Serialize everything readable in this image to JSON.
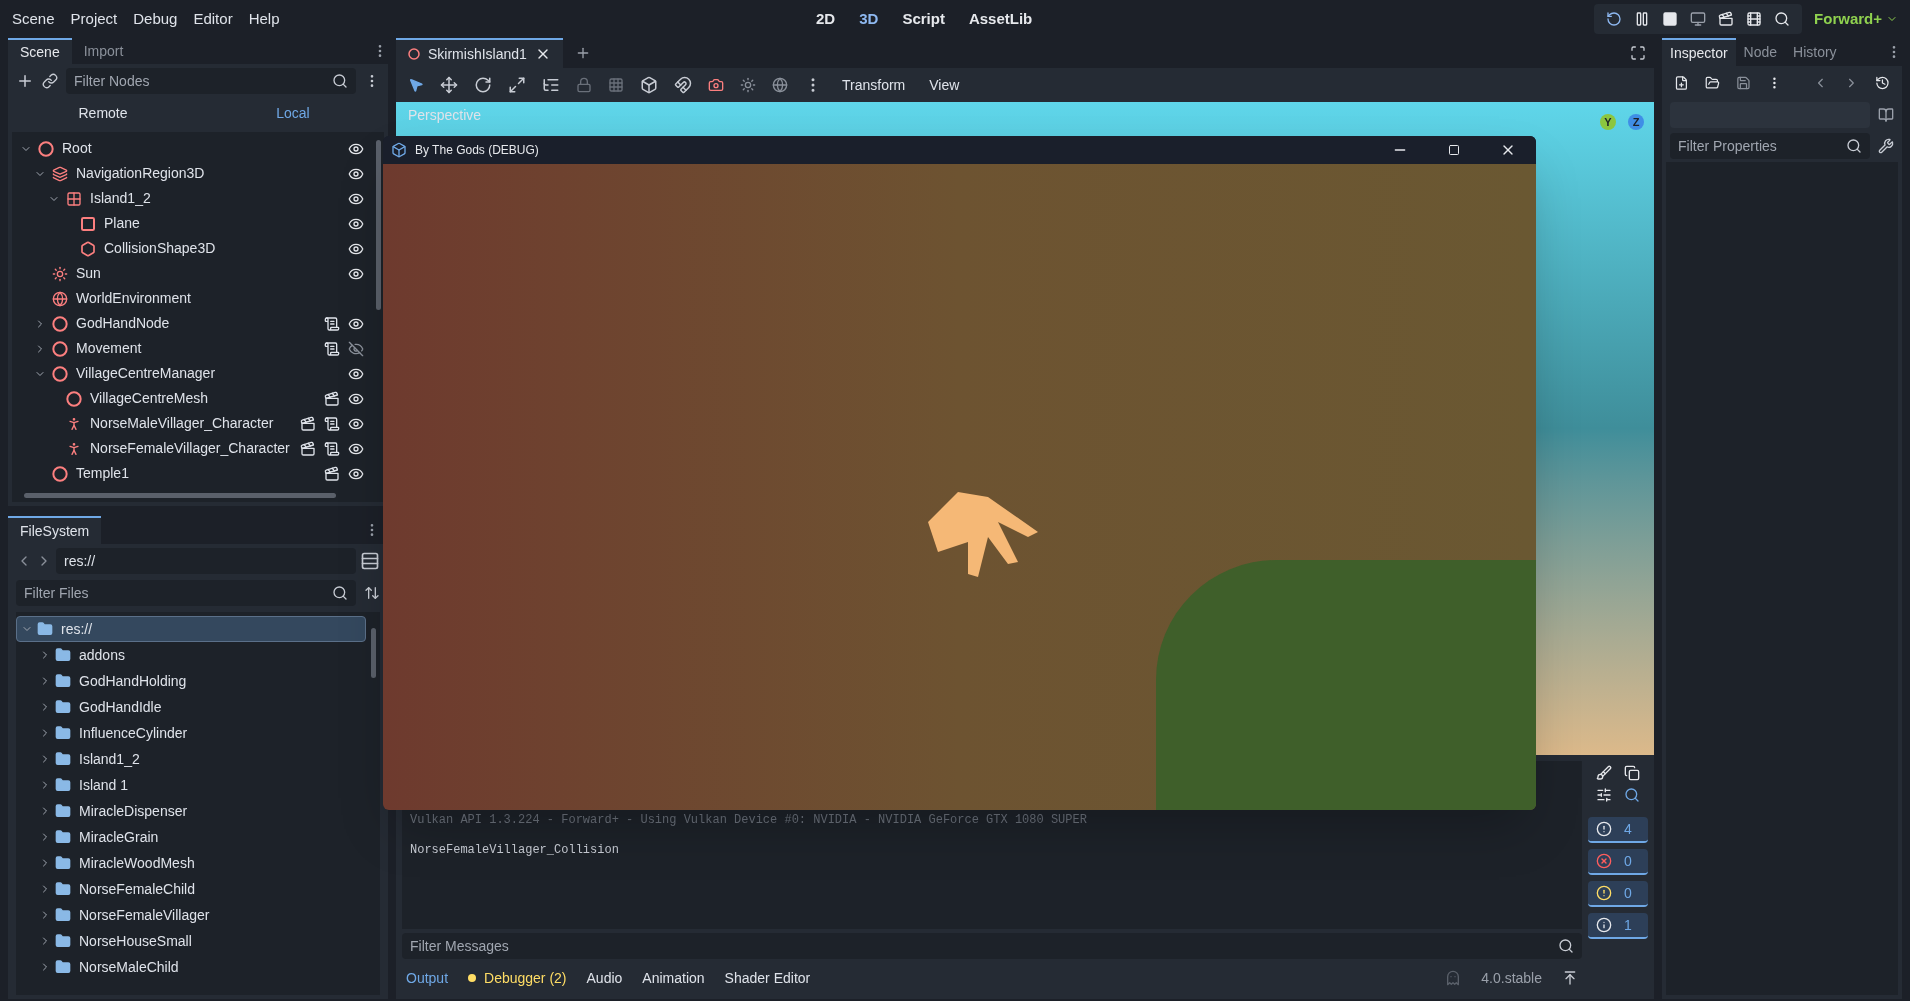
{
  "menu_bar": {
    "menus": [
      "Scene",
      "Project",
      "Debug",
      "Editor",
      "Help"
    ],
    "workspaces": [
      {
        "label": "2D",
        "selected": false
      },
      {
        "label": "3D",
        "selected": true
      },
      {
        "label": "Script",
        "selected": false
      },
      {
        "label": "AssetLib",
        "selected": false
      }
    ],
    "renderer": "Forward+"
  },
  "scene_dock": {
    "tabs": [
      {
        "label": "Scene",
        "selected": true
      },
      {
        "label": "Import",
        "selected": false
      }
    ],
    "filter_placeholder": "Filter Nodes",
    "modes": [
      {
        "label": "Remote",
        "selected": false
      },
      {
        "label": "Local",
        "selected": true
      }
    ],
    "tree": [
      {
        "name": "Root",
        "kind": "node3d",
        "expanded": true,
        "visible": true,
        "children": [
          {
            "name": "NavigationRegion3D",
            "kind": "navregion",
            "expanded": true,
            "visible": true,
            "children": [
              {
                "name": "Island1_2",
                "kind": "mesh",
                "expanded": true,
                "visible": true,
                "children": [
                  {
                    "name": "Plane",
                    "kind": "plane",
                    "visible": true
                  },
                  {
                    "name": "CollisionShape3D",
                    "kind": "collision",
                    "visible": true
                  }
                ]
              }
            ]
          },
          {
            "name": "Sun",
            "kind": "light",
            "visible": true
          },
          {
            "name": "WorldEnvironment",
            "kind": "environment"
          },
          {
            "name": "GodHandNode",
            "kind": "node3d",
            "expanded": false,
            "script": true,
            "visible": true
          },
          {
            "name": "Movement",
            "kind": "node3d",
            "expanded": false,
            "script": true,
            "visible": false
          },
          {
            "name": "VillageCentreManager",
            "kind": "node3d",
            "expanded": true,
            "visible": true,
            "children": [
              {
                "name": "VillageCentreMesh",
                "kind": "node3d",
                "instanced": true,
                "visible": true
              },
              {
                "name": "NorseMaleVillager_Character",
                "kind": "character",
                "instanced": true,
                "script": true,
                "visible": true
              },
              {
                "name": "NorseFemaleVillager_Character",
                "kind": "character",
                "instanced": true,
                "script": true,
                "visible": true
              }
            ]
          },
          {
            "name": "Temple1",
            "kind": "node3d",
            "instanced": true,
            "visible": true
          }
        ]
      }
    ]
  },
  "filesystem_dock": {
    "tab": "FileSystem",
    "path": "res://",
    "filter_placeholder": "Filter Files",
    "tree": [
      {
        "name": "res://",
        "selected": true,
        "expanded": true,
        "children": [
          {
            "name": "addons",
            "selected": false,
            "expanded": false
          },
          {
            "name": "GodHandHolding",
            "selected": false,
            "expanded": false
          },
          {
            "name": "GodHandIdle",
            "selected": false,
            "expanded": false
          },
          {
            "name": "InfluenceCylinder",
            "selected": false,
            "expanded": false
          },
          {
            "name": "Island1_2",
            "selected": false,
            "expanded": false
          },
          {
            "name": "Island 1",
            "selected": false,
            "expanded": false
          },
          {
            "name": "MiracleDispenser",
            "selected": false,
            "expanded": false
          },
          {
            "name": "MiracleGrain",
            "selected": false,
            "expanded": false
          },
          {
            "name": "MiracleWoodMesh",
            "selected": false,
            "expanded": false
          },
          {
            "name": "NorseFemaleChild",
            "selected": false,
            "expanded": false
          },
          {
            "name": "NorseFemaleVillager",
            "selected": false,
            "expanded": false
          },
          {
            "name": "NorseHouseSmall",
            "selected": false,
            "expanded": false
          },
          {
            "name": "NorseMaleChild",
            "selected": false,
            "expanded": false
          }
        ]
      }
    ]
  },
  "editor": {
    "scene_tabs": [
      {
        "label": "SkirmishIsland1",
        "selected": true
      }
    ],
    "toolbar_menus": [
      "Transform",
      "View"
    ],
    "viewport": {
      "label": "Perspective",
      "gizmo_axes": [
        {
          "label": "Y",
          "color": "#8cc63f"
        },
        {
          "label": "Z",
          "color": "#3f8ee6"
        }
      ]
    }
  },
  "game_window": {
    "title": "By The Gods (DEBUG)"
  },
  "bottom_panel": {
    "output_lines": [
      "Vulkan API 1.3.224 - Forward+ - Using Vulkan Device #0: NVIDIA - NVIDIA GeForce GTX 1080 SUPER",
      "NorseFemaleVillager_Collision"
    ],
    "filter_placeholder": "Filter Messages",
    "counters": [
      {
        "kind": "log",
        "count": "4",
        "selected": true
      },
      {
        "kind": "error",
        "count": "0",
        "selected": true
      },
      {
        "kind": "warning",
        "count": "0",
        "selected": true
      },
      {
        "kind": "info",
        "count": "1",
        "selected": true
      }
    ],
    "tabs": [
      {
        "label": "Output",
        "selected": true,
        "alert": false
      },
      {
        "label": "Debugger (2)",
        "selected": false,
        "alert": true
      },
      {
        "label": "Audio",
        "selected": false,
        "alert": false
      },
      {
        "label": "Animation",
        "selected": false,
        "alert": false
      },
      {
        "label": "Shader Editor",
        "selected": false,
        "alert": false
      }
    ],
    "version": "4.0.stable"
  },
  "inspector_dock": {
    "tabs": [
      {
        "label": "Inspector",
        "selected": true
      },
      {
        "label": "Node",
        "selected": false
      },
      {
        "label": "History",
        "selected": false
      }
    ],
    "filter_placeholder": "Filter Properties"
  }
}
